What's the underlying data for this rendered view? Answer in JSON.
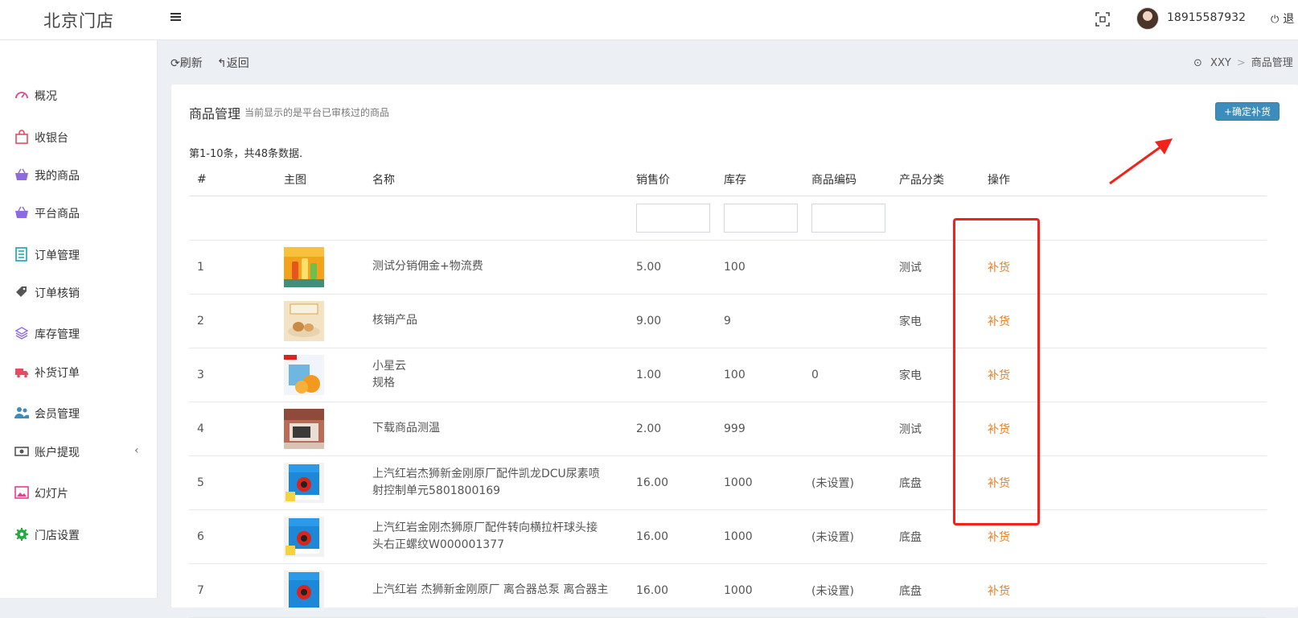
{
  "header": {
    "brand": "北京门店",
    "username": "18915587932",
    "logout_label": "退"
  },
  "sidebar": {
    "items": [
      {
        "label": "概况",
        "icon": "dashboard-icon"
      },
      {
        "label": "收银台",
        "icon": "shopping-bag-icon"
      },
      {
        "label": "我的商品",
        "icon": "basket-icon"
      },
      {
        "label": "平台商品",
        "icon": "basket-icon"
      },
      {
        "label": "订单管理",
        "icon": "list-icon"
      },
      {
        "label": "订单核销",
        "icon": "tag-icon"
      },
      {
        "label": "库存管理",
        "icon": "layers-icon"
      },
      {
        "label": "补货订单",
        "icon": "truck-icon"
      },
      {
        "label": "会员管理",
        "icon": "users-icon"
      },
      {
        "label": "账户提现",
        "icon": "money-icon",
        "has_submenu": true
      },
      {
        "label": "幻灯片",
        "icon": "image-icon"
      },
      {
        "label": "门店设置",
        "icon": "gear-icon"
      }
    ]
  },
  "toolbar": {
    "refresh_label": "刷新",
    "back_label": "返回"
  },
  "breadcrumb": {
    "root": "XXY",
    "current": "商品管理"
  },
  "card": {
    "title": "商品管理",
    "subtitle": "当前显示的是平台已审核过的商品",
    "confirm_button": "确定补货",
    "summary": "第1-10条，共48条数据."
  },
  "table": {
    "columns": [
      "#",
      "主图",
      "名称",
      "销售价",
      "库存",
      "商品编码",
      "产品分类",
      "操作"
    ],
    "rows": [
      {
        "no": "1",
        "name_line1": "测试分销佣金+物流费",
        "name_line2": "",
        "price": "5.00",
        "stock": "100",
        "code": "",
        "category": "测试",
        "action": "补货"
      },
      {
        "no": "2",
        "name_line1": "核销产品",
        "name_line2": "",
        "price": "9.00",
        "stock": "9",
        "code": "",
        "category": "家电",
        "action": "补货"
      },
      {
        "no": "3",
        "name_line1": "小星云",
        "name_line2": "规格",
        "price": "1.00",
        "stock": "100",
        "code": "0",
        "category": "家电",
        "action": "补货"
      },
      {
        "no": "4",
        "name_line1": "下载商品测温",
        "name_line2": "",
        "price": "2.00",
        "stock": "999",
        "code": "",
        "category": "测试",
        "action": "补货"
      },
      {
        "no": "5",
        "name_line1": "上汽红岩杰狮新金刚原厂配件凯龙DCU尿素喷",
        "name_line2": "射控制单元5801800169",
        "price": "16.00",
        "stock": "1000",
        "code": "(未设置)",
        "category": "底盘",
        "action": "补货"
      },
      {
        "no": "6",
        "name_line1": "上汽红岩金刚杰狮原厂配件转向横拉杆球头接",
        "name_line2": "头右正螺纹W000001377",
        "price": "16.00",
        "stock": "1000",
        "code": "(未设置)",
        "category": "底盘",
        "action": "补货"
      },
      {
        "no": "7",
        "name_line1": "上汽红岩 杰狮新金刚原厂 离合器总泵 离合器主",
        "name_line2": "",
        "price": "16.00",
        "stock": "1000",
        "code": "(未设置)",
        "category": "底盘",
        "action": "补货"
      }
    ]
  },
  "colors": {
    "accent": "#3c8dbc",
    "action": "#e67e22",
    "annotation": "#f0221a"
  }
}
